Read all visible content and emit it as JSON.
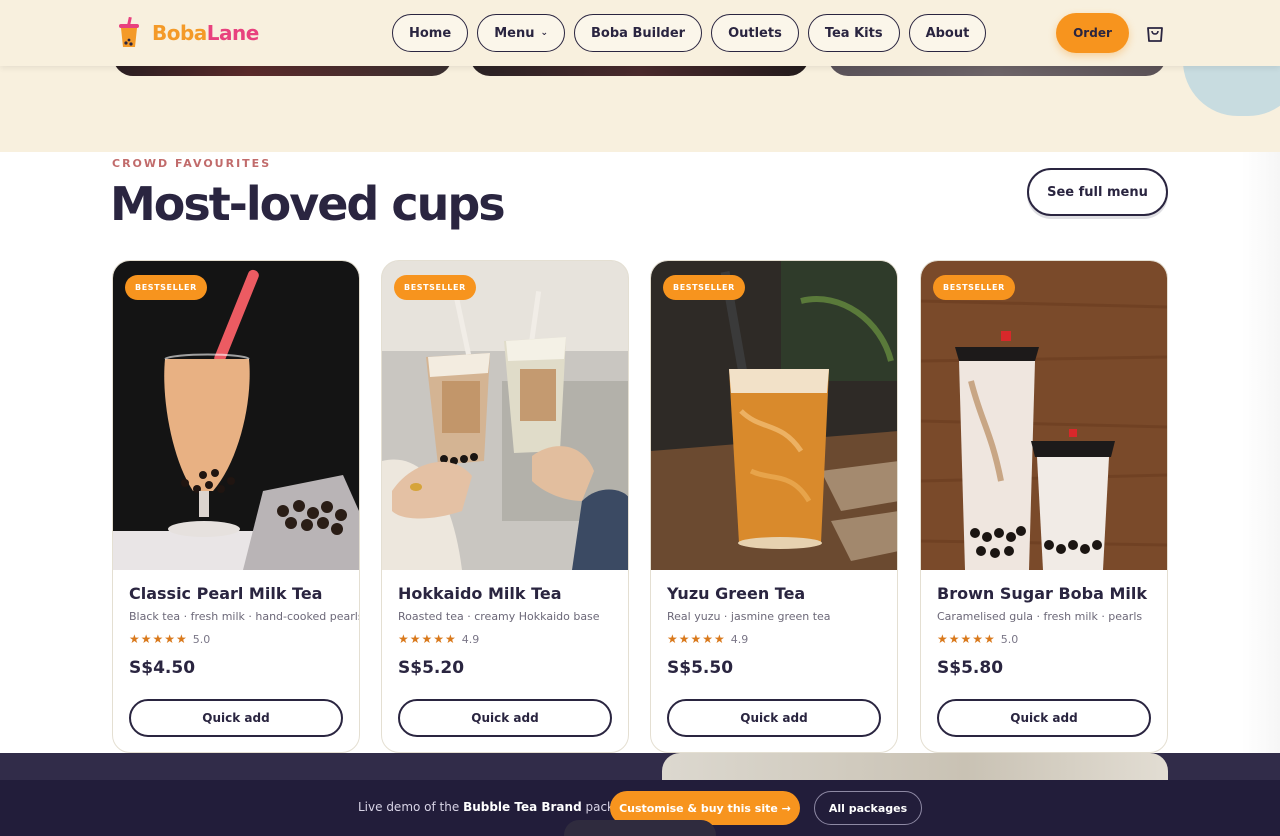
{
  "brand": {
    "part_a": "Boba",
    "part_b": "Lane"
  },
  "nav": {
    "items": [
      {
        "label": "Home"
      },
      {
        "label": "Menu"
      },
      {
        "label": "Boba Builder"
      },
      {
        "label": "Outlets"
      },
      {
        "label": "Tea Kits"
      },
      {
        "label": "About"
      }
    ],
    "order_label": "Order",
    "cart_icon": "shopping-bag-icon"
  },
  "section": {
    "eyebrow": "CROWD FAVOURITES",
    "title": "Most-loved cups",
    "see_menu_label": "See full menu"
  },
  "products": [
    {
      "badge": "BESTSELLER",
      "name": "Classic Pearl Milk Tea",
      "desc": "Black tea · fresh milk · hand-cooked pearls",
      "stars": "★★★★★",
      "rating": "5.0",
      "price": "S$4.50",
      "cta": "Quick add"
    },
    {
      "badge": "BESTSELLER",
      "name": "Hokkaido Milk Tea",
      "desc": "Roasted tea · creamy Hokkaido base",
      "stars": "★★★★★",
      "rating": "4.9",
      "price": "S$5.20",
      "cta": "Quick add"
    },
    {
      "badge": "BESTSELLER",
      "name": "Yuzu Green Tea",
      "desc": "Real yuzu · jasmine green tea",
      "stars": "★★★★★",
      "rating": "4.9",
      "price": "S$5.50",
      "cta": "Quick add"
    },
    {
      "badge": "BESTSELLER",
      "name": "Brown Sugar Boba Milk",
      "desc": "Caramelised gula · fresh milk · pearls",
      "stars": "★★★★★",
      "rating": "5.0",
      "price": "S$5.80",
      "cta": "Quick add"
    }
  ],
  "demo_bar": {
    "text_prefix": "Live demo of the ",
    "package_name": "Bubble Tea Brand",
    "text_suffix": " package.",
    "customise_label": "Customise & buy this site →",
    "all_packages_label": "All packages"
  },
  "colors": {
    "accent": "#f7941e",
    "brand_pink": "#e8417e",
    "ink": "#2a2540",
    "cream": "#f8f0de",
    "dark_band": "#221d3a"
  }
}
